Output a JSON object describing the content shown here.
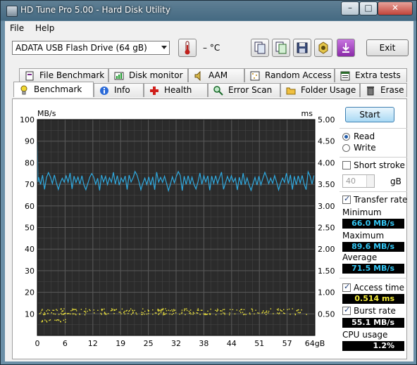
{
  "window": {
    "title": "HD Tune Pro 5.00 - Hard Disk Utility"
  },
  "menu": [
    "File",
    "Help"
  ],
  "toolbar": {
    "drive": "ADATA   USB Flash Drive  (64 gB)",
    "temperature": "– °C",
    "exit_label": "Exit",
    "icons": [
      "copy-icon",
      "copy-info-icon",
      "save-icon",
      "screenshot-icon",
      "download-icon"
    ]
  },
  "tabs_back": [
    {
      "label": "File Benchmark",
      "icon": "file-benchmark-icon"
    },
    {
      "label": "Disk monitor",
      "icon": "disk-monitor-icon"
    },
    {
      "label": "AAM",
      "icon": "speaker-icon"
    },
    {
      "label": "Random Access",
      "icon": "random-access-icon"
    },
    {
      "label": "Extra tests",
      "icon": "extra-tests-icon"
    }
  ],
  "tabs_front": [
    {
      "label": "Benchmark",
      "icon": "benchmark-icon",
      "active": true
    },
    {
      "label": "Info",
      "icon": "info-icon"
    },
    {
      "label": "Health",
      "icon": "health-icon"
    },
    {
      "label": "Error Scan",
      "icon": "error-scan-icon"
    },
    {
      "label": "Folder Usage",
      "icon": "folder-icon"
    },
    {
      "label": "Erase",
      "icon": "trash-icon"
    }
  ],
  "side": {
    "start_label": "Start",
    "read_label": "Read",
    "write_label": "Write",
    "mode": "Read",
    "short_stroke_label": "Short stroke",
    "short_stroke_checked": false,
    "stroke_value": "40",
    "stroke_unit": "gB",
    "transfer_rate_label": "Transfer rate",
    "transfer_rate_checked": true,
    "minimum_label": "Minimum",
    "minimum_value": "66.0 MB/s",
    "maximum_label": "Maximum",
    "maximum_value": "89.6 MB/s",
    "average_label": "Average",
    "average_value": "71.5 MB/s",
    "access_time_label": "Access time",
    "access_time_checked": true,
    "access_time_value": "0.514 ms",
    "burst_rate_label": "Burst rate",
    "burst_rate_checked": true,
    "burst_rate_value": "55.1 MB/s",
    "cpu_usage_label": "CPU usage",
    "cpu_usage_value": "1.2%"
  },
  "chart_data": {
    "type": "line",
    "left_unit": "MB/s",
    "right_unit": "ms",
    "x_unit": "gB",
    "x_ticks": [
      "0",
      "6",
      "12",
      "19",
      "25",
      "32",
      "38",
      "44",
      "51",
      "57",
      "64gB"
    ],
    "y_ticks_left": [
      "100",
      "90",
      "80",
      "70",
      "60",
      "50",
      "40",
      "30",
      "20",
      "10"
    ],
    "y_ticks_right": [
      "5.00",
      "4.50",
      "4.00",
      "3.50",
      "3.00",
      "2.50",
      "2.00",
      "1.50",
      "1.00",
      "0.50"
    ],
    "xlim": [
      0,
      64
    ],
    "ylim_left": [
      0,
      100
    ],
    "ylim_right": [
      0,
      5.0
    ],
    "grid": true,
    "background": "#2b2b2b",
    "grid_color": "#5a5a5a",
    "series": [
      {
        "name": "Transfer rate",
        "color": "#2fa9df",
        "axis": "left",
        "start_values": [
          89.6,
          71,
          72,
          73,
          75
        ],
        "x": [
          0.0,
          0.2,
          0.4,
          0.6,
          1.0,
          1.6,
          2.2,
          2.8,
          3.4,
          4.0,
          5.0,
          6.0,
          8.0,
          10.0,
          12.0,
          16.0,
          20.0,
          24.0,
          28.0,
          32.0,
          36.0,
          40.0,
          44.0,
          48.0,
          52.0,
          56.0,
          60.0,
          62.0,
          63.0,
          64.0
        ],
        "y": [
          89.6,
          71.0,
          72.0,
          73.0,
          75.0,
          71.5,
          73.5,
          70.0,
          73.0,
          71.0,
          73.5,
          70.5,
          73.0,
          71.0,
          73.5,
          70.5,
          73.0,
          71.5,
          73.5,
          70.5,
          73.0,
          71.0,
          73.5,
          70.5,
          73.0,
          71.5,
          73.0,
          74.0,
          71.0,
          72.0
        ],
        "range": [
          66.0,
          76.0
        ]
      },
      {
        "name": "Access time",
        "color": "#f0e63a",
        "axis": "right",
        "bands_ms": [
          0.6,
          0.52,
          0.35
        ],
        "x_range": [
          0,
          64
        ]
      }
    ]
  }
}
